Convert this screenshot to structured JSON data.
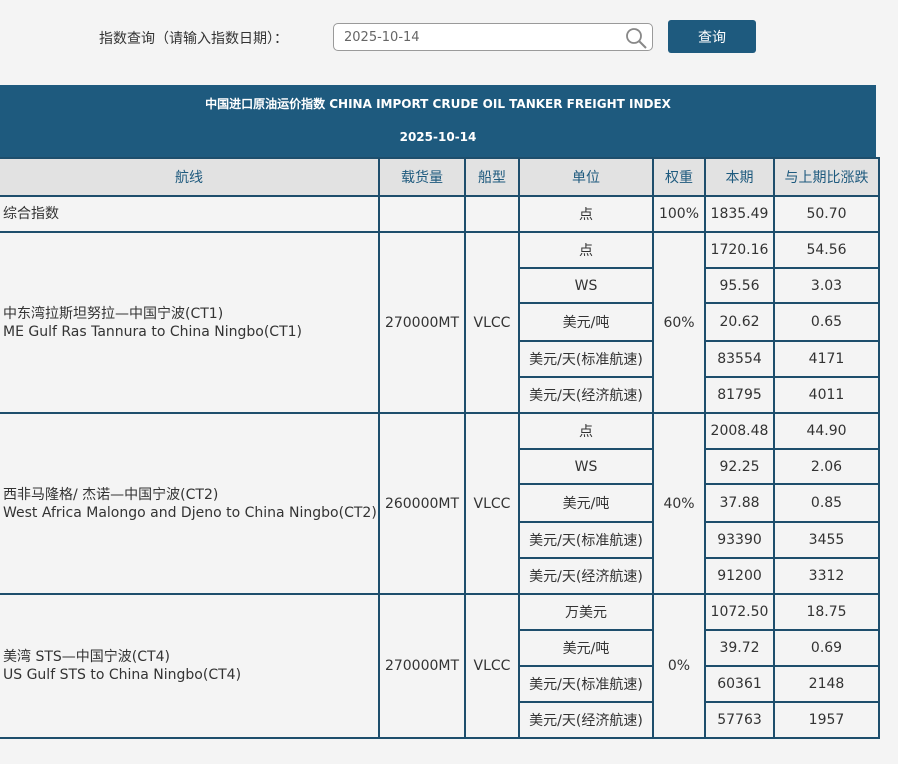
{
  "search": {
    "label": "指数查询（请输入指数日期）：",
    "value": "2025-10-14",
    "button_label": "查询"
  },
  "table": {
    "title": "中国进口原油运价指数 CHINA IMPORT CRUDE OIL TANKER FREIGHT INDEX",
    "date": "2025-10-14",
    "headers": [
      "航线",
      "载货量",
      "船型",
      "单位",
      "权重",
      "本期",
      "与上期比涨跌"
    ],
    "composite": {
      "route": "综合指数",
      "unit": "点",
      "weight": "100%",
      "current": "1835.49",
      "change": "50.70"
    },
    "groups": [
      {
        "route_cn": "中东湾拉斯坦努拉—中国宁波(CT1)",
        "route_en": "ME Gulf Ras Tannura to China Ningbo(CT1)",
        "cargo": "270000MT",
        "ship": "VLCC",
        "weight": "60%",
        "rows": [
          {
            "unit": "点",
            "current": "1720.16",
            "change": "54.56"
          },
          {
            "unit": "WS",
            "current": "95.56",
            "change": "3.03"
          },
          {
            "unit": "美元/吨",
            "current": "20.62",
            "change": "0.65"
          },
          {
            "unit": "美元/天(标准航速)",
            "current": "83554",
            "change": "4171"
          },
          {
            "unit": "美元/天(经济航速)",
            "current": "81795",
            "change": "4011"
          }
        ]
      },
      {
        "route_cn": "西非马隆格/ 杰诺—中国宁波(CT2)",
        "route_en": "West Africa Malongo and Djeno to China Ningbo(CT2)",
        "cargo": "260000MT",
        "ship": "VLCC",
        "weight": "40%",
        "rows": [
          {
            "unit": "点",
            "current": "2008.48",
            "change": "44.90"
          },
          {
            "unit": "WS",
            "current": "92.25",
            "change": "2.06"
          },
          {
            "unit": "美元/吨",
            "current": "37.88",
            "change": "0.85"
          },
          {
            "unit": "美元/天(标准航速)",
            "current": "93390",
            "change": "3455"
          },
          {
            "unit": "美元/天(经济航速)",
            "current": "91200",
            "change": "3312"
          }
        ]
      },
      {
        "route_cn": "美湾 STS—中国宁波(CT4)",
        "route_en": "US Gulf STS to China Ningbo(CT4)",
        "cargo": "270000MT",
        "ship": "VLCC",
        "weight": "0%",
        "rows": [
          {
            "unit": "万美元",
            "current": "1072.50",
            "change": "18.75"
          },
          {
            "unit": "美元/吨",
            "current": "39.72",
            "change": "0.69"
          },
          {
            "unit": "美元/天(标准航速)",
            "current": "60361",
            "change": "2148"
          },
          {
            "unit": "美元/天(经济航速)",
            "current": "57763",
            "change": "1957"
          }
        ]
      }
    ]
  },
  "colors": {
    "header_bg": "#1e5a7e",
    "border": "#1e4e6c",
    "head_cell_bg": "#e2e2e2",
    "page_bg": "#f4f4f4"
  }
}
